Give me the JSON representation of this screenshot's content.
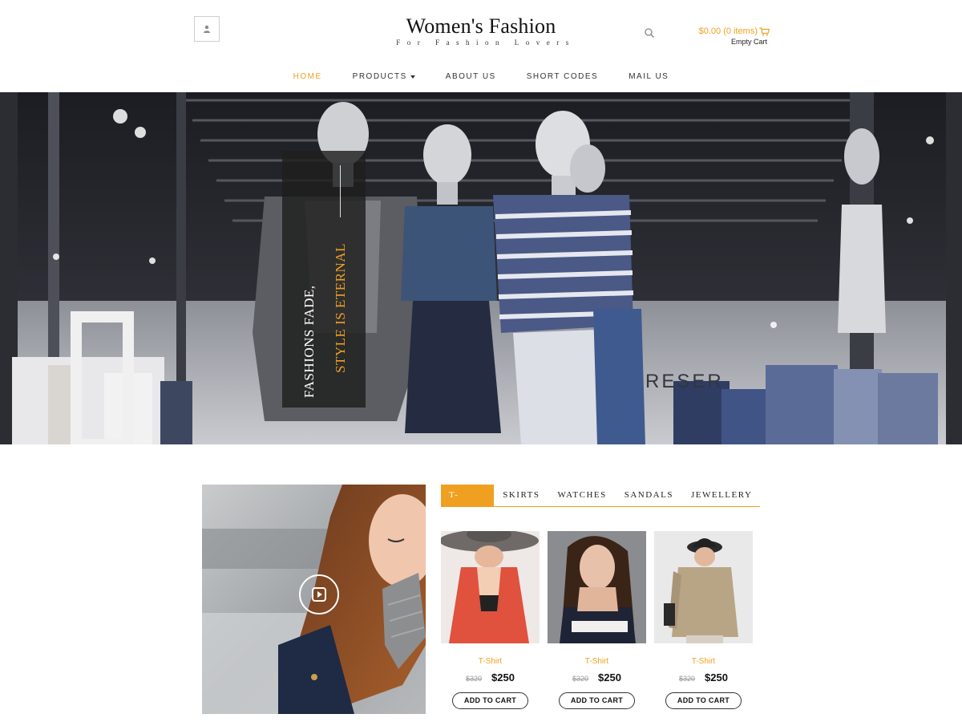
{
  "brand": {
    "title": "Women's Fashion",
    "tagline": "For Fashion Lovers"
  },
  "header": {
    "user_icon": "user-icon",
    "search_icon": "search-icon",
    "cart": {
      "total": "$0.00 (0 items)",
      "status": "Empty Cart",
      "icon": "cart-icon"
    }
  },
  "nav": {
    "items": [
      {
        "label": "HOME"
      },
      {
        "label": "PRODUCTS"
      },
      {
        "label": "ABOUT US"
      },
      {
        "label": "SHORT CODES"
      },
      {
        "label": "MAIL US"
      }
    ]
  },
  "hero": {
    "line1": "FASHIONS FADE,",
    "line2": "STYLE IS ETERNAL"
  },
  "video": {
    "play_icon": "play-icon"
  },
  "tabs": {
    "items": [
      {
        "label": "T-SHIRTS"
      },
      {
        "label": "SKIRTS"
      },
      {
        "label": "WATCHES"
      },
      {
        "label": "SANDALS"
      },
      {
        "label": "JEWELLERY"
      }
    ]
  },
  "products": [
    {
      "name": "T-Shirt",
      "old_price": "$320",
      "price": "$250",
      "button": "ADD TO CART"
    },
    {
      "name": "T-Shirt",
      "old_price": "$320",
      "price": "$250",
      "button": "ADD TO CART"
    },
    {
      "name": "T-Shirt",
      "old_price": "$320",
      "price": "$250",
      "button": "ADD TO CART"
    }
  ],
  "colors": {
    "accent": "#f0a020",
    "text": "#222222",
    "banner_bg": "#1e1e1e"
  }
}
